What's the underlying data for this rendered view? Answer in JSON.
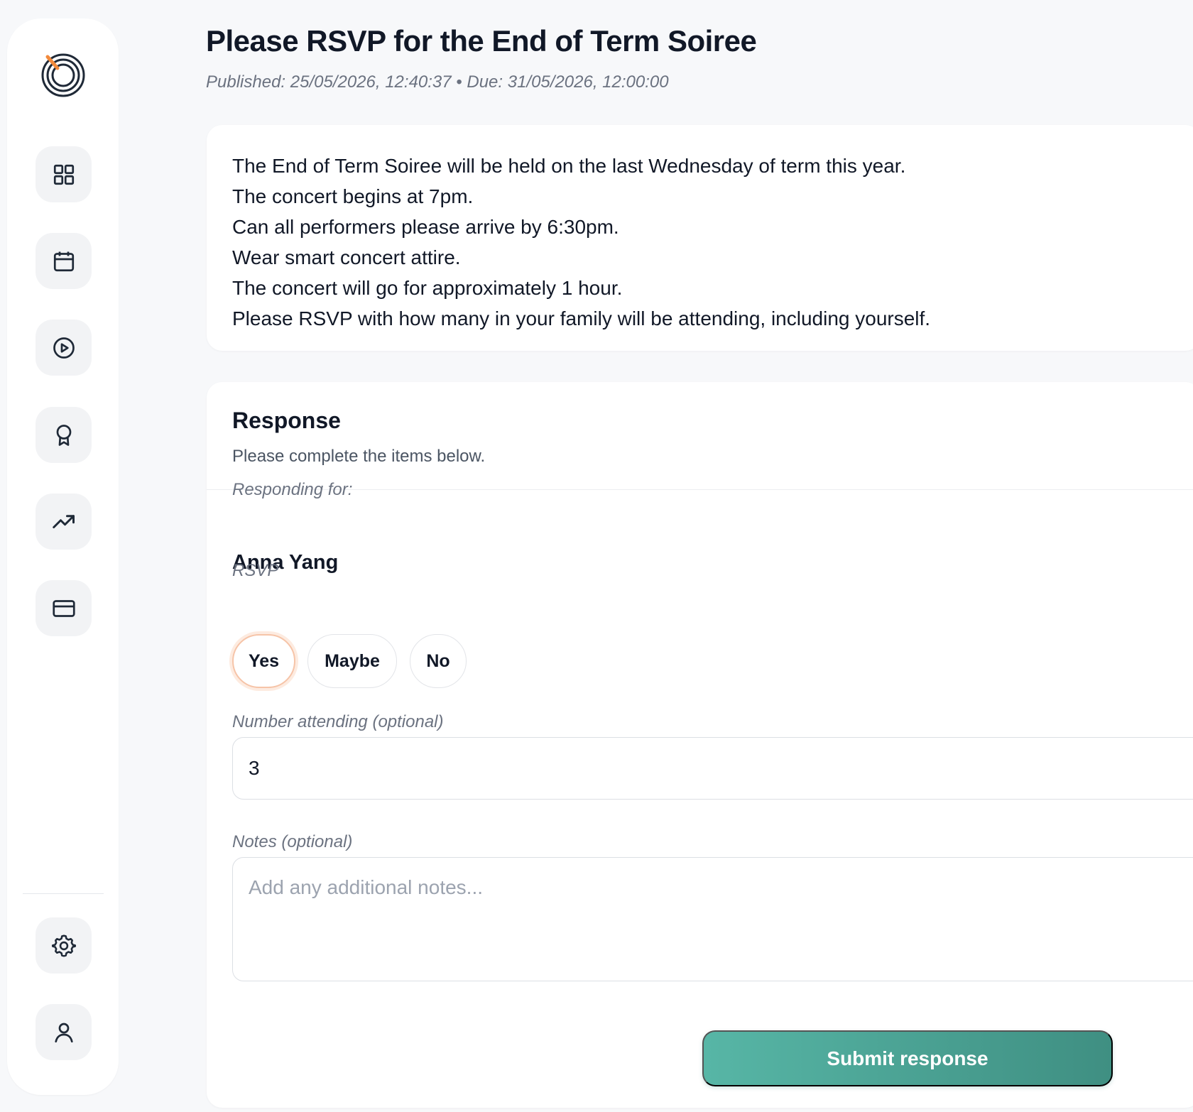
{
  "sidebar": {
    "logo": "target-logo-icon",
    "nav": [
      {
        "icon": "dashboard-icon"
      },
      {
        "icon": "calendar-icon"
      },
      {
        "icon": "play-circle-icon"
      },
      {
        "icon": "award-icon"
      },
      {
        "icon": "trending-up-icon"
      },
      {
        "icon": "credit-card-icon"
      }
    ],
    "bottom": [
      {
        "icon": "gear-icon"
      },
      {
        "icon": "user-icon"
      }
    ]
  },
  "header": {
    "title": "Please RSVP for the End of Term Soiree",
    "meta": "Published: 25/05/2026, 12:40:37 • Due: 31/05/2026, 12:00:00"
  },
  "description": {
    "lines": [
      "The End of Term Soiree will be held on the last Wednesday of term this year.",
      "The concert begins at 7pm.",
      "Can all performers please arrive by 6:30pm.",
      "Wear smart concert attire.",
      "The concert will go for approximately 1 hour.",
      "Please RSVP with how many in your family will be attending, including yourself."
    ]
  },
  "response": {
    "title": "Response",
    "subtitle": "Please complete the items below.",
    "responding_for_label": "Responding for:",
    "person_name": "Anna Yang",
    "rsvp_label": "RSVP",
    "rsvp_options": [
      "Yes",
      "Maybe",
      "No"
    ],
    "rsvp_selected": "Yes",
    "number_label": "Number attending (optional)",
    "number_value": "3",
    "notes_label": "Notes (optional)",
    "notes_placeholder": "Add any additional notes...",
    "submit_label": "Submit response"
  },
  "colors": {
    "accent": "#4fa899",
    "selected_ring": "#f6c4a8",
    "logo_accent": "#f28a3c"
  }
}
